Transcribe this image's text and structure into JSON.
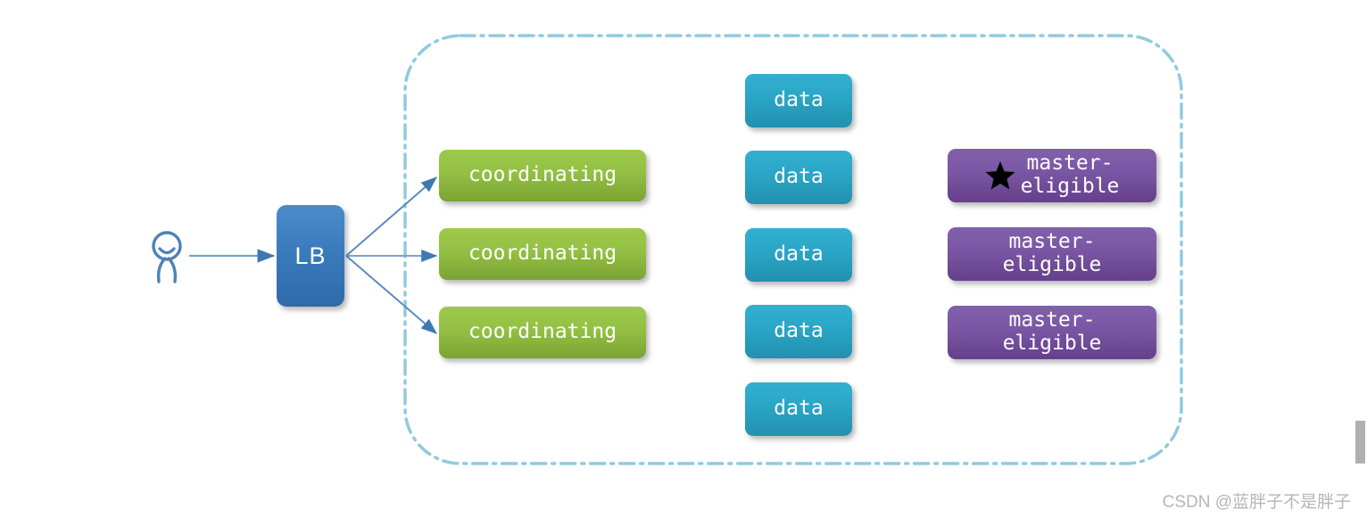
{
  "diagram": {
    "title": "Elasticsearch cluster node roles topology",
    "actor": {
      "name": "user-actor",
      "label": ""
    },
    "load_balancer": {
      "label": "LB"
    },
    "cluster_boundary": {
      "label": "",
      "border_color": "#8fcbdf",
      "style": "dash-dot"
    },
    "coordinating_nodes": [
      {
        "label": "coordinating"
      },
      {
        "label": "coordinating"
      },
      {
        "label": "coordinating"
      }
    ],
    "data_nodes": [
      {
        "label": "data"
      },
      {
        "label": "data"
      },
      {
        "label": "data"
      },
      {
        "label": "data"
      },
      {
        "label": "data"
      }
    ],
    "master_eligible_nodes": [
      {
        "label": "master-\neligible",
        "elected": true,
        "badge": "star-icon"
      },
      {
        "label": "master-\neligible",
        "elected": false,
        "badge": ""
      },
      {
        "label": "master-\neligible",
        "elected": false,
        "badge": ""
      }
    ],
    "colors": {
      "lb_blue": "#3b7cbe",
      "coordinating_green": "#93c044",
      "data_cyan": "#2ba5c6",
      "master_purple": "#7a57a4",
      "boundary_blue": "#8fcbdf",
      "arrow_blue": "#4a7fb5",
      "star_black": "#000000"
    },
    "connections": [
      {
        "from": "user-actor",
        "to": "LB"
      },
      {
        "from": "LB",
        "to": "coordinating-1"
      },
      {
        "from": "LB",
        "to": "coordinating-2"
      },
      {
        "from": "LB",
        "to": "coordinating-3"
      }
    ]
  },
  "watermark": {
    "text": "CSDN @蓝胖子不是胖子"
  }
}
